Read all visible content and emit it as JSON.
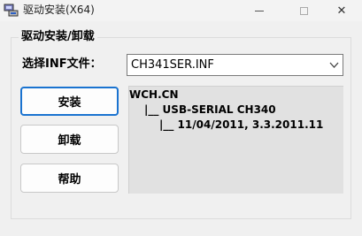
{
  "window": {
    "title": "驱动安装(X64)",
    "controls": {
      "minimize": "minimize",
      "maximize": "maximize",
      "close": "✕"
    }
  },
  "group": {
    "title": "驱动安装/卸载"
  },
  "inf": {
    "label": "选择INF文件：",
    "selected": "CH341SER.INF"
  },
  "buttons": {
    "install": "安装",
    "uninstall": "卸载",
    "help": "帮助"
  },
  "info": {
    "lines": [
      "WCH.CN",
      "|__ USB-SERIAL CH340",
      "|__ 11/04/2011, 3.3.2011.11"
    ]
  },
  "colors": {
    "focus_border": "#1a73d0",
    "info_bg": "#e1e1e1",
    "window_bg": "#f0f0f0"
  }
}
